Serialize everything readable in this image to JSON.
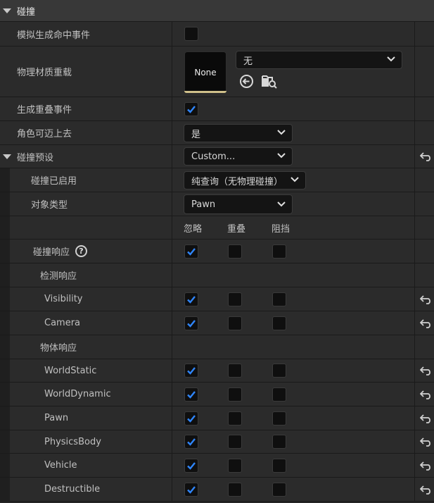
{
  "section": {
    "title": "碰撞"
  },
  "rows": {
    "sim_hit": {
      "label": "模拟生成命中事件",
      "checked": false
    },
    "phys_mat": {
      "label": "物理材质重载",
      "thumb": "None",
      "combo": "无"
    },
    "overlap": {
      "label": "生成重叠事件",
      "checked": true
    },
    "step_up": {
      "label": "角色可迈上去",
      "combo": "是"
    },
    "presets": {
      "label": "碰撞预设",
      "combo": "Custom..."
    },
    "enabled": {
      "label": "碰撞已启用",
      "combo": "纯查询（无物理碰撞）"
    },
    "obj_type": {
      "label": "对象类型",
      "combo": "Pawn"
    },
    "headers": {
      "ignore": "忽略",
      "overlap": "重叠",
      "block": "阻挡"
    },
    "response": {
      "label": "碰撞响应",
      "help": "?"
    },
    "trace_resp": {
      "label": "检测响应"
    },
    "object_resp": {
      "label": "物体响应"
    }
  },
  "channels": [
    {
      "label": "Visibility",
      "ignore": true,
      "overlap": false,
      "block": false
    },
    {
      "label": "Camera",
      "ignore": true,
      "overlap": false,
      "block": false
    },
    {
      "label": "WorldStatic",
      "ignore": true,
      "overlap": false,
      "block": false
    },
    {
      "label": "WorldDynamic",
      "ignore": true,
      "overlap": false,
      "block": false
    },
    {
      "label": "Pawn",
      "ignore": true,
      "overlap": false,
      "block": false
    },
    {
      "label": "PhysicsBody",
      "ignore": true,
      "overlap": false,
      "block": false
    },
    {
      "label": "Vehicle",
      "ignore": true,
      "overlap": false,
      "block": false
    },
    {
      "label": "Destructible",
      "ignore": true,
      "overlap": false,
      "block": false
    }
  ],
  "colors": {
    "check": "#2f86ff",
    "accent_line": "#cfc08a"
  },
  "icons": [
    "chevron-down-icon",
    "expand-triangle-icon",
    "reset-arrow-icon",
    "use-selected-icon",
    "browse-icon",
    "help-icon",
    "checkmark-icon"
  ]
}
